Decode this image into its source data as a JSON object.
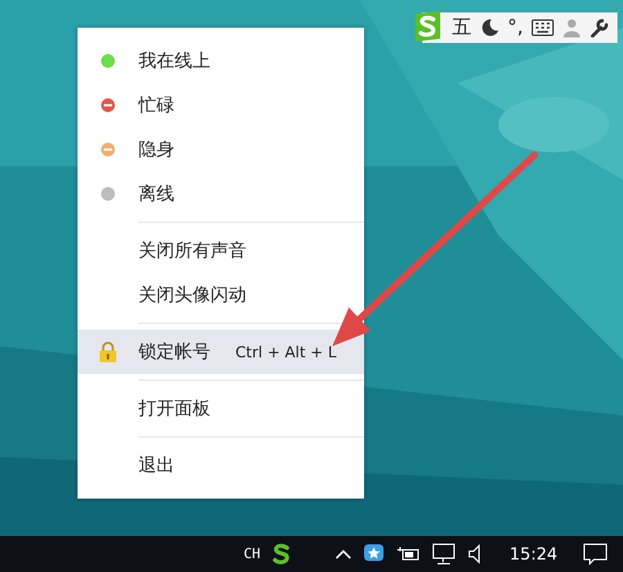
{
  "ime_toolbar": {
    "mode": "五",
    "punctuation": "°,"
  },
  "menu": {
    "sections": [
      [
        {
          "kind": "dot",
          "label": "我在线上",
          "color": "#6fdc4a",
          "selected": false
        },
        {
          "kind": "dot-minus",
          "label": "忙碌",
          "color": "#e0584a",
          "selected": false
        },
        {
          "kind": "dot-minus",
          "label": "隐身",
          "color": "#eeb06c",
          "selected": false
        },
        {
          "kind": "dot",
          "label": "离线",
          "color": "#bdbdbd",
          "selected": false
        }
      ],
      [
        {
          "kind": "plain",
          "label": "关闭所有声音",
          "selected": false
        },
        {
          "kind": "plain",
          "label": "关闭头像闪动",
          "selected": false
        }
      ],
      [
        {
          "kind": "lock",
          "label": "锁定帐号",
          "shortcut": "Ctrl + Alt + L",
          "selected": true
        }
      ],
      [
        {
          "kind": "plain",
          "label": "打开面板",
          "selected": false
        }
      ],
      [
        {
          "kind": "plain",
          "label": "退出",
          "selected": false
        }
      ]
    ]
  },
  "taskbar": {
    "input_language": "CH",
    "clock": "15:24"
  }
}
